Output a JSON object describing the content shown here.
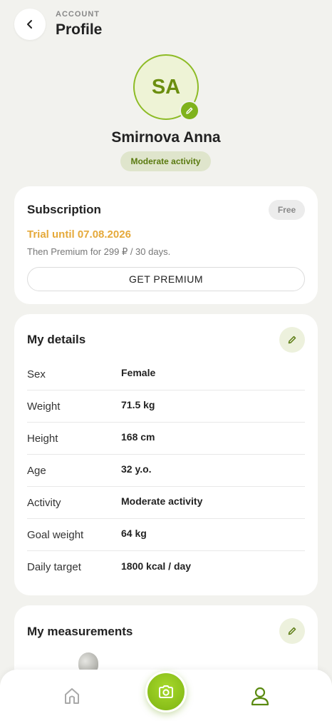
{
  "header": {
    "eyebrow": "ACCOUNT",
    "title": "Profile"
  },
  "user": {
    "initials": "SA",
    "name": "Smirnova Anna",
    "activity_badge": "Moderate activity"
  },
  "subscription": {
    "title": "Subscription",
    "plan_badge": "Free",
    "trial_text": "Trial until 07.08.2026",
    "then_text": "Then Premium for 299 ₽ / 30 days.",
    "cta_label": "GET PREMIUM"
  },
  "details": {
    "title": "My details",
    "rows": [
      {
        "label": "Sex",
        "value": "Female"
      },
      {
        "label": "Weight",
        "value": "71.5 kg"
      },
      {
        "label": "Height",
        "value": "168 cm"
      },
      {
        "label": "Age",
        "value": "32 y.o."
      },
      {
        "label": "Activity",
        "value": "Moderate activity"
      },
      {
        "label": "Goal weight",
        "value": "64 kg"
      },
      {
        "label": "Daily target",
        "value": "1800 kcal / day"
      }
    ]
  },
  "measurements": {
    "title": "My measurements"
  },
  "nav": {
    "items": [
      "home-icon",
      "camera-icon",
      "profile-icon"
    ],
    "active": "profile"
  },
  "colors": {
    "accent": "#7fb21c",
    "accent_dark": "#6b8e0f",
    "trial": "#e5a93a",
    "background": "#f2f2ee"
  }
}
